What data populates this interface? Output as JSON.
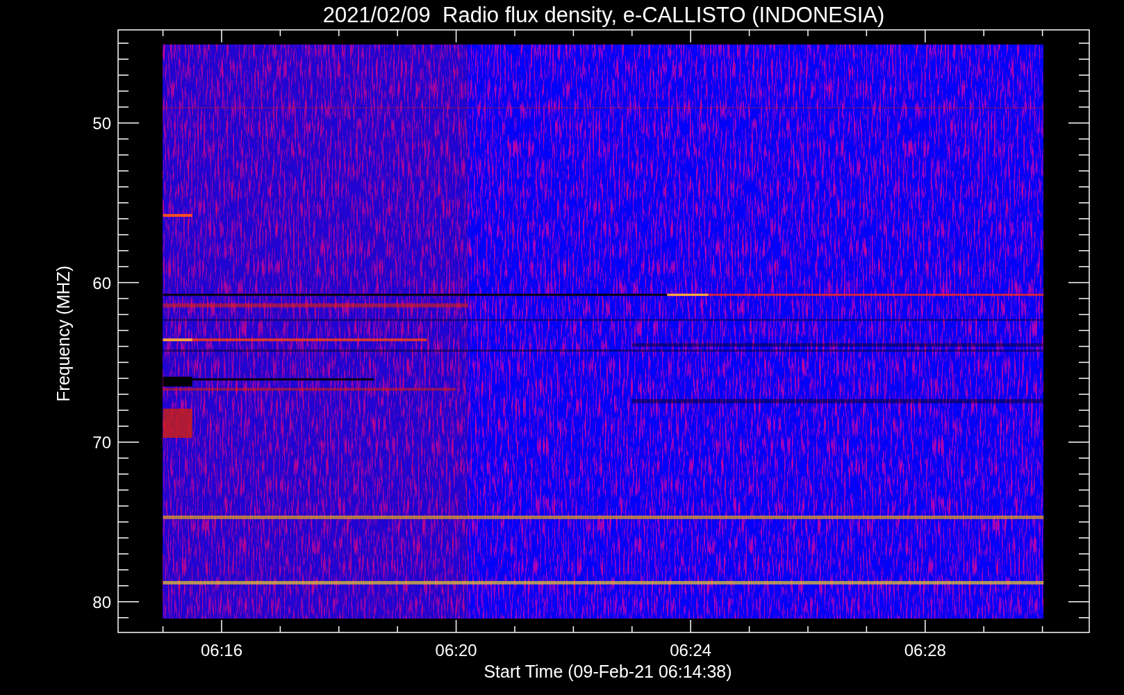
{
  "title": "2021/02/09  Radio flux density, e-CALLISTO (INDONESIA)",
  "y_axis": {
    "label": "Frequency (MHZ)",
    "ticks": [
      "50",
      "60",
      "70",
      "80"
    ]
  },
  "x_axis": {
    "label": "Start Time (09-Feb-21 06:14:38)",
    "ticks": [
      "06:16",
      "06:20",
      "06:24",
      "06:28"
    ]
  }
}
